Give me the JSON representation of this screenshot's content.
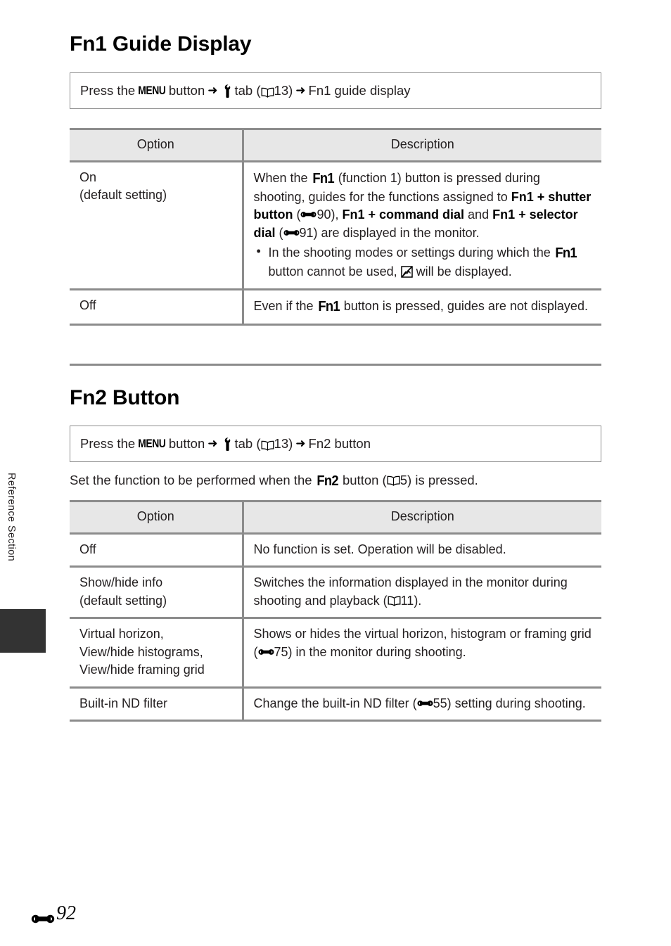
{
  "page": {
    "running_head": "Reference Section",
    "folio_icon": "dumbbell-icon",
    "folio_number": "92"
  },
  "sections": [
    {
      "id": "fn1",
      "title": "Fn1 Guide Display",
      "path": {
        "prefix": "Press the ",
        "menu_label": "MENU",
        "mid": " button ",
        "arrow": "➜",
        "tab_icon": "wrench-icon",
        "tab_label": " tab (",
        "book_icon": "book-icon",
        "page_ref": "13",
        "close": ") ",
        "destination": "Fn1 guide display"
      },
      "table": {
        "headers": [
          "Option",
          "Description"
        ],
        "rows": [
          {
            "option": "On",
            "option_sub": "(default setting)",
            "desc_prefix": "When the ",
            "desc_fn": "Fn1",
            "desc_p1_a": " (function 1) button is pressed during shooting, guides for the functions assigned to ",
            "desc_b1": "Fn1 + shutter button",
            "desc_p1_b": " (",
            "ref1_icon": "dumbbell-icon",
            "ref1": "90",
            "desc_p1_c": "), ",
            "desc_b2": "Fn1 + command dial",
            "desc_p1_d": " and ",
            "desc_b3": "Fn1 + selector dial",
            "desc_p1_e": " (",
            "ref2_icon": "dumbbell-icon",
            "ref2": "91",
            "desc_p1_f": ") are displayed in the monitor.",
            "bullet_a": "In the shooting modes or settings during which the ",
            "bullet_fn": "Fn1",
            "bullet_b": " button cannot be used, ",
            "bullet_icon": "nopict-icon",
            "bullet_c": " will be displayed."
          },
          {
            "option": "Off",
            "option_sub": "",
            "desc_prefix": "Even if the ",
            "desc_fn": "Fn1",
            "desc_suffix": " button is pressed, guides are not displayed."
          }
        ]
      }
    },
    {
      "id": "fn2",
      "title": "Fn2 Button",
      "path": {
        "prefix": "Press the ",
        "menu_label": "MENU",
        "mid": " button ",
        "arrow": "➜",
        "tab_icon": "wrench-icon",
        "tab_label": " tab (",
        "book_icon": "book-icon",
        "page_ref": "13",
        "close": ") ",
        "destination": "Fn2 button"
      },
      "lead": {
        "a": "Set the function to be performed when the ",
        "fn": "Fn2",
        "b": " button (",
        "book_icon": "book-icon",
        "page_ref": "5",
        "c": ") is pressed."
      },
      "table": {
        "headers": [
          "Option",
          "Description"
        ],
        "rows": [
          {
            "option": "Off",
            "desc": "No function is set. Operation will be disabled."
          },
          {
            "option": "Show/hide info",
            "option_sub": "(default setting)",
            "desc_a": "Switches the information displayed in the monitor during shooting and playback (",
            "book_icon": "book-icon",
            "ref": "11",
            "desc_b": ")."
          },
          {
            "option": "Virtual horizon,",
            "option_sub": "View/hide histograms,",
            "option_sub2": "View/hide framing grid",
            "desc_a": "Shows or hides the virtual horizon, histogram or framing grid (",
            "ref_icon": "dumbbell-icon",
            "ref": "75",
            "desc_b": ") in the monitor during shooting."
          },
          {
            "option": "Built-in ND filter",
            "desc_a": "Change the built-in ND filter (",
            "ref_icon": "dumbbell-icon",
            "ref": "55",
            "desc_b": ") setting during shooting."
          }
        ]
      }
    }
  ],
  "colors": {
    "rule": "#8c8c8c",
    "header_fill": "#e7e7e7",
    "text": "#231f20",
    "tab_fill": "#333333"
  }
}
